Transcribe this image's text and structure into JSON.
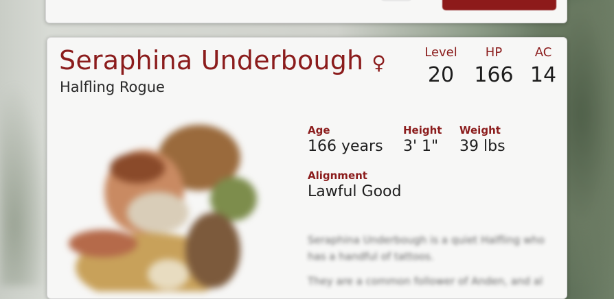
{
  "character": {
    "name": "Seraphina Underbough",
    "gender_symbol": "♀",
    "race_class": "Halfling Rogue",
    "stats": {
      "level_label": "Level",
      "level": "20",
      "hp_label": "HP",
      "hp": "166",
      "ac_label": "AC",
      "ac": "14"
    },
    "details": {
      "age_label": "Age",
      "age": "166 years",
      "height_label": "Height",
      "height": "3' 1\"",
      "weight_label": "Weight",
      "weight": "39 lbs",
      "alignment_label": "Alignment",
      "alignment": "Lawful Good"
    },
    "description": [
      "Seraphina Underbough is a quiet Halfling who has a handful of tattoos.",
      "They are a common follower of Anden, and al"
    ]
  },
  "colors": {
    "accent": "#8b1c1c",
    "button": "#8d1a1a",
    "card": "#f7f7f6"
  }
}
